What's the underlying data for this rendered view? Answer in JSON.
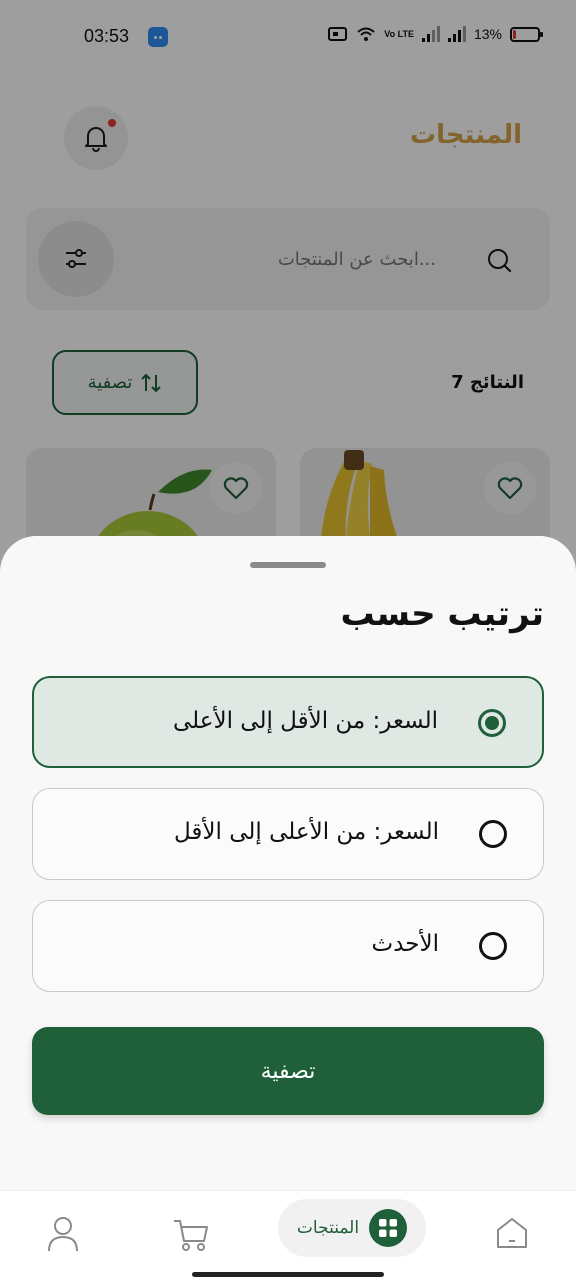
{
  "status_bar": {
    "time": "03:53",
    "battery_text": "13%",
    "battery_level": 0.13,
    "volte_label": "Vo LTE",
    "icons": [
      "android-app-icon",
      "card-icon",
      "wifi-icon",
      "signal-icon",
      "signal-icon",
      "battery-icon"
    ]
  },
  "header": {
    "title": "المنتجات",
    "bell_icon": "bell-icon",
    "has_notification": true
  },
  "search": {
    "placeholder": "ابحث عن المنتجات...",
    "search_icon": "search-icon",
    "filter_icon": "sliders-icon"
  },
  "results": {
    "count_text": "7 النتائج",
    "sort_chip_label": "تصفية",
    "sort_icon": "sort-arrows-icon"
  },
  "product_cards": [
    {
      "image": "banana",
      "fav_icon": "heart-icon"
    },
    {
      "image": "green-apple",
      "fav_icon": "heart-icon"
    }
  ],
  "sort_sheet": {
    "title": "ترتيب حسب",
    "options": [
      {
        "label": "السعر: من الأقل إلى الأعلى",
        "selected": true
      },
      {
        "label": "السعر: من الأعلى إلى الأقل",
        "selected": false
      },
      {
        "label": "الأحدث",
        "selected": false
      }
    ],
    "apply_label": "تصفية"
  },
  "bottom_nav": {
    "active_label": "المنتجات",
    "items": [
      {
        "name": "home",
        "icon": "home-icon"
      },
      {
        "name": "products",
        "icon": "grid-icon"
      },
      {
        "name": "cart",
        "icon": "cart-icon"
      },
      {
        "name": "profile",
        "icon": "user-icon"
      }
    ]
  },
  "colors": {
    "brand_green": "#1f5f3a",
    "title_gold": "#d4a24a",
    "selected_bg": "#dfe8e2",
    "notification_dot": "#e53935"
  }
}
